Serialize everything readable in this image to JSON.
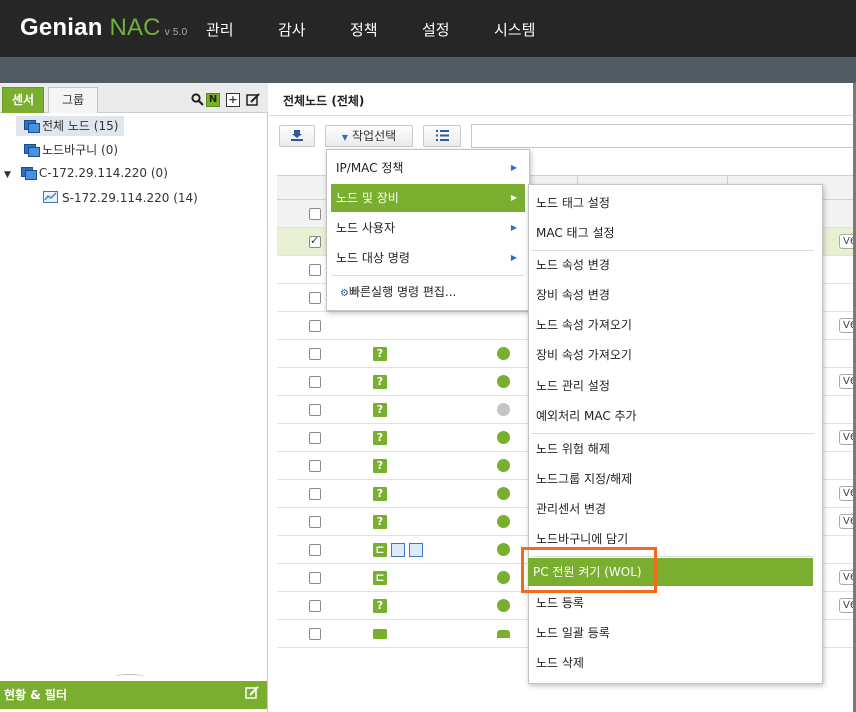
{
  "app": {
    "logo_main": "Genian",
    "logo_accent": "NAC",
    "version": "v 5.0"
  },
  "topnav": [
    "관리",
    "감사",
    "정책",
    "설정",
    "시스템"
  ],
  "left_panel": {
    "tabs": [
      "센서",
      "그룹"
    ],
    "tools": {
      "n_label": "N",
      "add_label": "+",
      "search_icon": "search-icon",
      "edit_icon": "edit-icon"
    },
    "tree": [
      {
        "label": "전체 노드 (15)",
        "icon": "node-icon"
      },
      {
        "label": "노드바구니 (0)",
        "icon": "node-icon"
      },
      {
        "label": "C-172.29.114.220 (0)",
        "icon": "node-icon"
      },
      {
        "label": "S-172.29.114.220 (14)",
        "icon": "sensor-icon"
      }
    ],
    "footer_label": "현황 & 필터"
  },
  "main": {
    "title": "전체노드 (전체)",
    "action_button": "작업선택",
    "rows": [
      {
        "checked": false,
        "device": "",
        "status": "",
        "badge": ""
      },
      {
        "checked": true,
        "device": "",
        "status": "",
        "badge": "V6"
      },
      {
        "checked": false,
        "device": "",
        "status": "",
        "badge": ""
      },
      {
        "checked": false,
        "device": "",
        "status": "",
        "badge": ""
      },
      {
        "checked": false,
        "device": "",
        "status": "",
        "badge": "V6"
      },
      {
        "checked": false,
        "device": "?",
        "status": "green",
        "badge": ""
      },
      {
        "checked": false,
        "device": "?",
        "status": "green",
        "badge": "V6"
      },
      {
        "checked": false,
        "device": "?",
        "status": "grey",
        "badge": ""
      },
      {
        "checked": false,
        "device": "?",
        "status": "green",
        "badge": "V6"
      },
      {
        "checked": false,
        "device": "?",
        "status": "green",
        "badge": ""
      },
      {
        "checked": false,
        "device": "?",
        "status": "green",
        "badge": "V6"
      },
      {
        "checked": false,
        "device": "?",
        "status": "green",
        "badge": "V6"
      },
      {
        "checked": false,
        "device": "plug",
        "status": "green",
        "badge": ""
      },
      {
        "checked": false,
        "device": "plug",
        "status": "green",
        "badge": "V6"
      },
      {
        "checked": false,
        "device": "?",
        "status": "green",
        "badge": "V6"
      },
      {
        "checked": false,
        "device": "switch",
        "status": "net",
        "badge": ""
      }
    ]
  },
  "menu_primary": {
    "items": [
      {
        "label": "IP/MAC 정책",
        "submenu": true
      },
      {
        "label": "노드 및 장비",
        "submenu": true,
        "active": true
      },
      {
        "label": "노드 사용자",
        "submenu": true
      },
      {
        "label": "노드 대상 명령",
        "submenu": true
      }
    ],
    "quick_edit": "빠른실행 명령 편집..."
  },
  "menu_secondary": {
    "items": [
      "노드 태그 설정",
      "MAC 태그 설정",
      "노드 속성 변경",
      "장비 속성 변경",
      "노드 속성 가져오기",
      "장비 속성 가져오기",
      "노드 관리 설정",
      "예외처리 MAC 추가",
      "노드 위험 해제",
      "노드그룹 지정/해제",
      "관리센서 변경",
      "노드바구니에 담기",
      "PC 전원 켜기 (WOL)",
      "노드 등록",
      "노드 일괄 등록",
      "노드 삭제"
    ],
    "active_index": 12
  },
  "colors": {
    "accent_green": "#7aae2e",
    "topbar": "#262626",
    "highlight": "#f26a1b"
  }
}
